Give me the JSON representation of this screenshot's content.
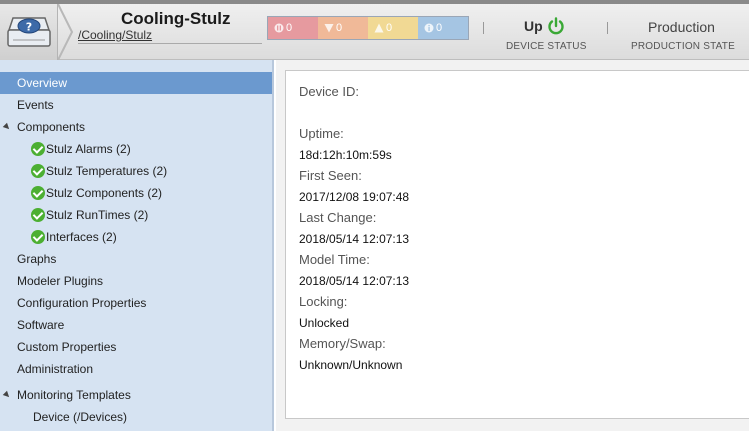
{
  "header": {
    "device_title": "Cooling-Stulz",
    "device_path": "/Cooling/Stulz",
    "events": [
      {
        "name": "critical",
        "count": "0",
        "color": "#e69a9f"
      },
      {
        "name": "error",
        "count": "0",
        "color": "#f0b998"
      },
      {
        "name": "warning",
        "count": "0",
        "color": "#f1d994"
      },
      {
        "name": "info",
        "count": "0",
        "color": "#a5c5e3"
      }
    ],
    "device_status": {
      "value": "Up",
      "label": "DEVICE STATUS",
      "icon": "power-icon",
      "color": "#3aa835"
    },
    "production_state": {
      "value": "Production",
      "label": "PRODUCTION STATE"
    }
  },
  "sidebar": {
    "items": [
      {
        "label": "Overview"
      },
      {
        "label": "Events"
      },
      {
        "label": "Components"
      },
      {
        "label": "Stulz Alarms (2)"
      },
      {
        "label": "Stulz Temperatures (2)"
      },
      {
        "label": "Stulz Components (2)"
      },
      {
        "label": "Stulz RunTimes (2)"
      },
      {
        "label": "Interfaces (2)"
      },
      {
        "label": "Graphs"
      },
      {
        "label": "Modeler Plugins"
      },
      {
        "label": "Configuration Properties"
      },
      {
        "label": "Software"
      },
      {
        "label": "Custom Properties"
      },
      {
        "label": "Administration"
      },
      {
        "label": "Monitoring Templates"
      },
      {
        "label": "Device (/Devices)"
      }
    ],
    "selected_color": "#6b99cf"
  },
  "overview": {
    "device_id_label": "Device ID:",
    "uptime_label": "Uptime:",
    "uptime_value": "18d:12h:10m:59s",
    "first_seen_label": "First Seen:",
    "first_seen_value": "2017/12/08 19:07:48",
    "last_change_label": "Last Change:",
    "last_change_value": "2018/05/14 12:07:13",
    "model_time_label": "Model Time:",
    "model_time_value": "2018/05/14 12:07:13",
    "locking_label": "Locking:",
    "locking_value": "Unlocked",
    "memory_swap_label": "Memory/Swap:",
    "memory_swap_value": "Unknown/Unknown"
  }
}
